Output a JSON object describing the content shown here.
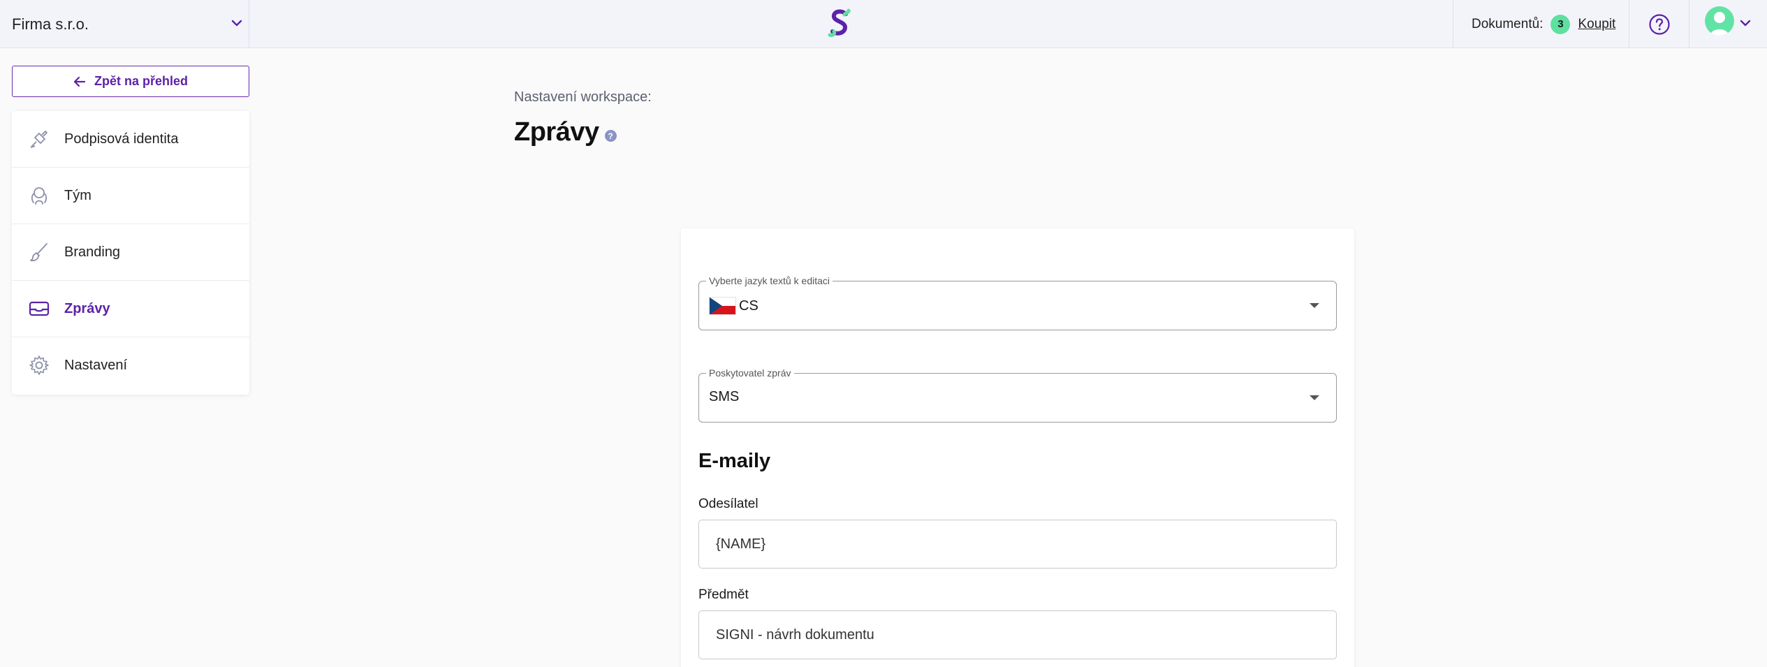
{
  "header": {
    "company": "Firma s.r.o.",
    "documents_label": "Dokumentů:",
    "documents_count": "3",
    "buy_label": "Koupit"
  },
  "sidebar": {
    "back_label": "Zpět na přehled",
    "items": [
      {
        "label": "Podpisová identita",
        "icon": "pen-nib-icon",
        "active": false
      },
      {
        "label": "Tým",
        "icon": "team-icon",
        "active": false
      },
      {
        "label": "Branding",
        "icon": "brush-icon",
        "active": false
      },
      {
        "label": "Zprávy",
        "icon": "envelope-icon",
        "active": true
      },
      {
        "label": "Nastavení",
        "icon": "gear-icon",
        "active": false
      }
    ]
  },
  "main": {
    "breadcrumb": "Nastavení workspace:",
    "title": "Zprávy",
    "language_select": {
      "legend": "Vyberte jazyk textů k editaci",
      "value": "CS"
    },
    "provider_select": {
      "legend": "Poskytovatel zpráv",
      "value": "SMS"
    },
    "emails_title": "E-maily",
    "sender": {
      "label": "Odesílatel",
      "value": "{NAME}"
    },
    "subject": {
      "label": "Předmět",
      "value": "SIGNI - návrh dokumentu"
    }
  },
  "colors": {
    "accent": "#5c22a8",
    "badge": "#5fe0a0",
    "avatar": "#62e3a6"
  }
}
